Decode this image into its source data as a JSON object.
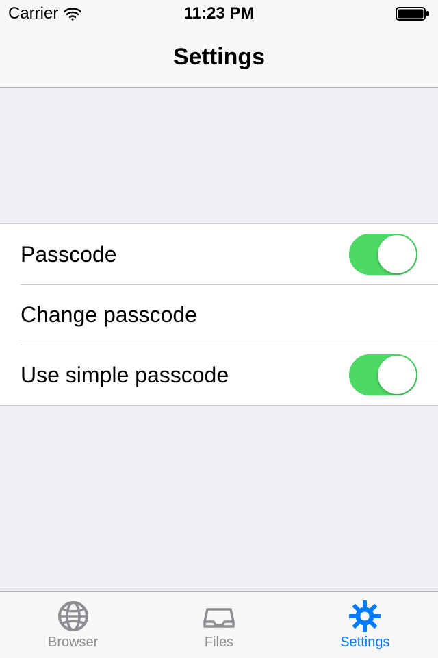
{
  "statusBar": {
    "carrier": "Carrier",
    "time": "11:23 PM"
  },
  "navBar": {
    "title": "Settings"
  },
  "settings": {
    "passcode": {
      "label": "Passcode",
      "enabled": true
    },
    "changePasscode": {
      "label": "Change passcode"
    },
    "simplePasscode": {
      "label": "Use simple passcode",
      "enabled": true
    }
  },
  "tabBar": {
    "browser": {
      "label": "Browser"
    },
    "files": {
      "label": "Files"
    },
    "settings": {
      "label": "Settings"
    },
    "activeTab": "settings"
  },
  "colors": {
    "tint": "#007aff",
    "toggleOn": "#4cd964",
    "inactive": "#8e8e93"
  }
}
